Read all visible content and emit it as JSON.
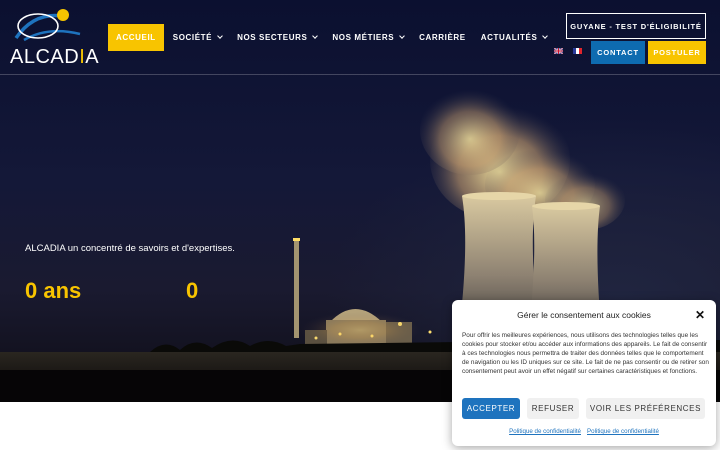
{
  "brand": {
    "logo_main": "ALCAD",
    "logo_i": "I",
    "logo_end": "A",
    "accent_color": "#f8c400",
    "blue_color": "#0e6bb0"
  },
  "nav": {
    "items": [
      {
        "label": "Accueil",
        "active": true
      },
      {
        "label": "Société",
        "dropdown": true
      },
      {
        "label": "Nos secteurs",
        "dropdown": true
      },
      {
        "label": "Nos métiers",
        "dropdown": true
      },
      {
        "label": "Carrière"
      },
      {
        "label": "Actualités",
        "dropdown": true
      }
    ]
  },
  "header": {
    "guyane_button": "GUYANE - TEST D'ÉLIGIBILITÉ",
    "contact_button": "CONTACT",
    "postuler_button": "POSTULER",
    "flags": [
      "en-flag-icon",
      "fr-flag-icon"
    ]
  },
  "hero": {
    "tagline": "ALCADIA un concentré de savoirs et d'expertises.",
    "counter_1": "0 ans",
    "counter_2": "0"
  },
  "cookie": {
    "title": "Gérer le consentement aux cookies",
    "close": "✕",
    "text": "Pour offrir les meilleures expériences, nous utilisons des technologies telles que les cookies pour stocker et/ou accéder aux informations des appareils. Le fait de consentir à ces technologies nous permettra de traiter des données telles que le comportement de navigation ou les ID uniques sur ce site. Le fait de ne pas consentir ou de retirer son consentement peut avoir un effet négatif sur certaines caractéristiques et fonctions.",
    "accept": "ACCEPTER",
    "refuse": "REFUSER",
    "preferences": "VOIR LES PRÉFÉRENCES",
    "link_1": "Politique de confidentialité",
    "link_2": "Politique de confidentialité"
  }
}
